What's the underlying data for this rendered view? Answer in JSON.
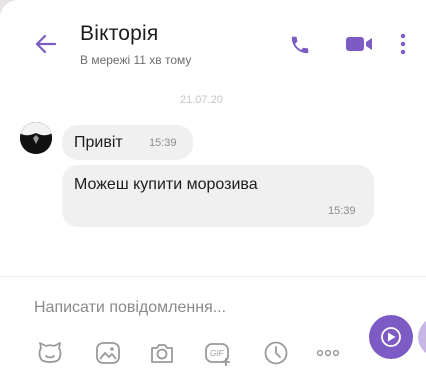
{
  "header": {
    "contact_name": "Вікторія",
    "status": "В мережі 11 хв тому"
  },
  "chat": {
    "date_divider": "21.07.20",
    "messages": [
      {
        "text": "Привіт",
        "time": "15:39"
      },
      {
        "text": "Можеш купити морозива",
        "time": "15:39"
      }
    ]
  },
  "composer": {
    "placeholder": "Написати повідомлення...",
    "toolbar": [
      "sticker-icon",
      "gallery-icon",
      "camera-icon",
      "gif-icon",
      "timer-icon",
      "more-icon"
    ]
  },
  "colors": {
    "accent": "#7d5bc4",
    "bubble": "#f0f0f0",
    "text": "#1c1c1c",
    "muted": "#8c8c8c"
  }
}
